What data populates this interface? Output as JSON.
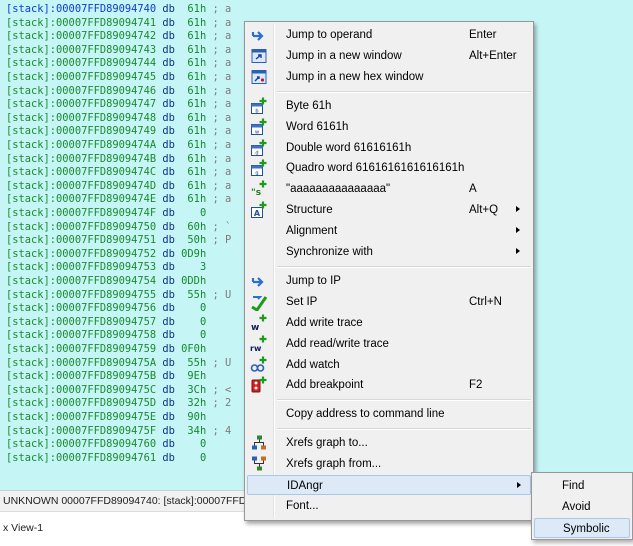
{
  "listing": {
    "lines": [
      {
        "seg": "[stack]",
        "addr": ":00007FFD89094740",
        "mnem": " db ",
        "operand": " 61h",
        "comment": " ; a",
        "selected": true
      },
      {
        "seg": "[stack]",
        "addr": ":00007FFD89094741",
        "mnem": " db ",
        "operand": " 61h",
        "comment": " ; a"
      },
      {
        "seg": "[stack]",
        "addr": ":00007FFD89094742",
        "mnem": " db ",
        "operand": " 61h",
        "comment": " ; a"
      },
      {
        "seg": "[stack]",
        "addr": ":00007FFD89094743",
        "mnem": " db ",
        "operand": " 61h",
        "comment": " ; a"
      },
      {
        "seg": "[stack]",
        "addr": ":00007FFD89094744",
        "mnem": " db ",
        "operand": " 61h",
        "comment": " ; a"
      },
      {
        "seg": "[stack]",
        "addr": ":00007FFD89094745",
        "mnem": " db ",
        "operand": " 61h",
        "comment": " ; a"
      },
      {
        "seg": "[stack]",
        "addr": ":00007FFD89094746",
        "mnem": " db ",
        "operand": " 61h",
        "comment": " ; a"
      },
      {
        "seg": "[stack]",
        "addr": ":00007FFD89094747",
        "mnem": " db ",
        "operand": " 61h",
        "comment": " ; a"
      },
      {
        "seg": "[stack]",
        "addr": ":00007FFD89094748",
        "mnem": " db ",
        "operand": " 61h",
        "comment": " ; a"
      },
      {
        "seg": "[stack]",
        "addr": ":00007FFD89094749",
        "mnem": " db ",
        "operand": " 61h",
        "comment": " ; a"
      },
      {
        "seg": "[stack]",
        "addr": ":00007FFD8909474A",
        "mnem": " db ",
        "operand": " 61h",
        "comment": " ; a"
      },
      {
        "seg": "[stack]",
        "addr": ":00007FFD8909474B",
        "mnem": " db ",
        "operand": " 61h",
        "comment": " ; a"
      },
      {
        "seg": "[stack]",
        "addr": ":00007FFD8909474C",
        "mnem": " db ",
        "operand": " 61h",
        "comment": " ; a"
      },
      {
        "seg": "[stack]",
        "addr": ":00007FFD8909474D",
        "mnem": " db ",
        "operand": " 61h",
        "comment": " ; a"
      },
      {
        "seg": "[stack]",
        "addr": ":00007FFD8909474E",
        "mnem": " db ",
        "operand": " 61h",
        "comment": " ; a"
      },
      {
        "seg": "[stack]",
        "addr": ":00007FFD8909474F",
        "mnem": " db ",
        "operand": "   0",
        "comment": ""
      },
      {
        "seg": "[stack]",
        "addr": ":00007FFD89094750",
        "mnem": " db ",
        "operand": " 60h",
        "comment": " ; `"
      },
      {
        "seg": "[stack]",
        "addr": ":00007FFD89094751",
        "mnem": " db ",
        "operand": " 50h",
        "comment": " ; P"
      },
      {
        "seg": "[stack]",
        "addr": ":00007FFD89094752",
        "mnem": " db ",
        "operand": "0D9h",
        "comment": ""
      },
      {
        "seg": "[stack]",
        "addr": ":00007FFD89094753",
        "mnem": " db ",
        "operand": "   3",
        "comment": ""
      },
      {
        "seg": "[stack]",
        "addr": ":00007FFD89094754",
        "mnem": " db ",
        "operand": "0DDh",
        "comment": ""
      },
      {
        "seg": "[stack]",
        "addr": ":00007FFD89094755",
        "mnem": " db ",
        "operand": " 55h",
        "comment": " ; U"
      },
      {
        "seg": "[stack]",
        "addr": ":00007FFD89094756",
        "mnem": " db ",
        "operand": "   0",
        "comment": ""
      },
      {
        "seg": "[stack]",
        "addr": ":00007FFD89094757",
        "mnem": " db ",
        "operand": "   0",
        "comment": ""
      },
      {
        "seg": "[stack]",
        "addr": ":00007FFD89094758",
        "mnem": " db ",
        "operand": "   0",
        "comment": ""
      },
      {
        "seg": "[stack]",
        "addr": ":00007FFD89094759",
        "mnem": " db ",
        "operand": "0F0h",
        "comment": ""
      },
      {
        "seg": "[stack]",
        "addr": ":00007FFD8909475A",
        "mnem": " db ",
        "operand": " 55h",
        "comment": " ; U"
      },
      {
        "seg": "[stack]",
        "addr": ":00007FFD8909475B",
        "mnem": " db ",
        "operand": " 9Eh",
        "comment": ""
      },
      {
        "seg": "[stack]",
        "addr": ":00007FFD8909475C",
        "mnem": " db ",
        "operand": " 3Ch",
        "comment": " ; <"
      },
      {
        "seg": "[stack]",
        "addr": ":00007FFD8909475D",
        "mnem": " db ",
        "operand": " 32h",
        "comment": " ; 2"
      },
      {
        "seg": "[stack]",
        "addr": ":00007FFD8909475E",
        "mnem": " db ",
        "operand": " 90h",
        "comment": ""
      },
      {
        "seg": "[stack]",
        "addr": ":00007FFD8909475F",
        "mnem": " db ",
        "operand": " 34h",
        "comment": " ; 4"
      },
      {
        "seg": "[stack]",
        "addr": ":00007FFD89094760",
        "mnem": " db ",
        "operand": "   0",
        "comment": ""
      },
      {
        "seg": "[stack]",
        "addr": ":00007FFD89094761",
        "mnem": " db ",
        "operand": "   0",
        "comment": ""
      }
    ]
  },
  "status_bar": {
    "text": "UNKNOWN 00007FFD89094740: [stack]:00007FFD89"
  },
  "tab": {
    "label": "x View-1"
  },
  "context_menu": {
    "items": [
      {
        "label": "Jump to operand",
        "shortcut": "Enter",
        "icon": "jump-arrow-icon"
      },
      {
        "label": "Jump in a new window",
        "shortcut": "Alt+Enter",
        "icon": "new-window-icon"
      },
      {
        "label": "Jump in a new hex window",
        "shortcut": "",
        "icon": "hex-window-icon"
      },
      {
        "sep": true
      },
      {
        "label": "Byte 61h",
        "shortcut": "",
        "icon": "data-byte-icon"
      },
      {
        "label": "Word 6161h",
        "shortcut": "",
        "icon": "data-word-icon"
      },
      {
        "label": "Double word 61616161h",
        "shortcut": "",
        "icon": "data-dword-icon"
      },
      {
        "label": "Quadro word 6161616161616161h",
        "shortcut": "",
        "icon": "data-qword-icon"
      },
      {
        "label": "\"aaaaaaaaaaaaaaa\"",
        "shortcut": "A",
        "icon": "string-icon"
      },
      {
        "label": "Structure",
        "shortcut": "Alt+Q",
        "icon": "structure-icon",
        "submenu": true
      },
      {
        "label": "Alignment",
        "shortcut": "",
        "icon": "",
        "submenu": true
      },
      {
        "label": "Synchronize with",
        "shortcut": "",
        "icon": "",
        "submenu": true
      },
      {
        "sep": true
      },
      {
        "label": "Jump to IP",
        "shortcut": "",
        "icon": "jump-ip-icon"
      },
      {
        "label": "Set IP",
        "shortcut": "Ctrl+N",
        "icon": "set-ip-icon"
      },
      {
        "label": "Add write trace",
        "shortcut": "",
        "icon": "write-trace-icon"
      },
      {
        "label": "Add read/write trace",
        "shortcut": "",
        "icon": "readwrite-trace-icon"
      },
      {
        "label": "Add watch",
        "shortcut": "",
        "icon": "watch-icon"
      },
      {
        "label": "Add breakpoint",
        "shortcut": "F2",
        "icon": "breakpoint-icon"
      },
      {
        "sep": true
      },
      {
        "label": "Copy address to command line",
        "shortcut": "",
        "icon": ""
      },
      {
        "sep": true
      },
      {
        "label": "Xrefs graph to...",
        "shortcut": "",
        "icon": "xrefs-to-icon"
      },
      {
        "label": "Xrefs graph from...",
        "shortcut": "",
        "icon": "xrefs-from-icon"
      },
      {
        "label": "IDAngr",
        "shortcut": "",
        "icon": "",
        "submenu": true,
        "highlighted": true
      },
      {
        "label": "Font...",
        "shortcut": "",
        "icon": ""
      }
    ]
  },
  "submenu": {
    "items": [
      {
        "label": "Find"
      },
      {
        "label": "Avoid"
      },
      {
        "label": "Symbolic",
        "highlighted": true
      }
    ]
  },
  "colors": {
    "listing_bg": "#c6f5f5",
    "address_green": "#1b8a30",
    "selected_blue": "#0b3dd6",
    "menu_bg": "#f0f0f0",
    "highlight_bg": "#dde9f6"
  }
}
